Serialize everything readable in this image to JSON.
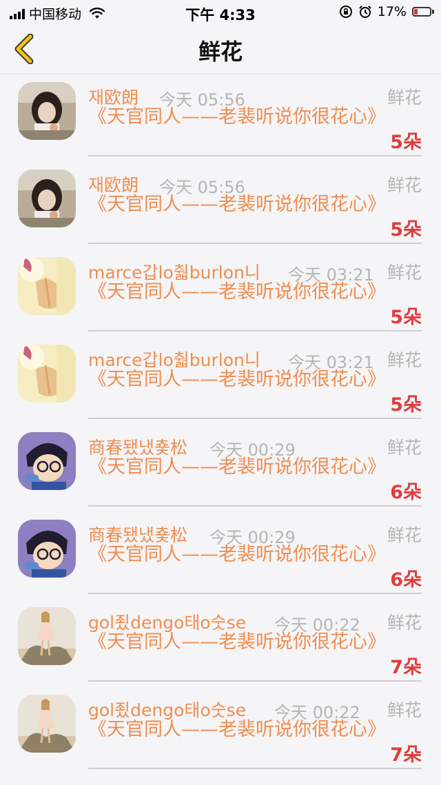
{
  "status_bar": {
    "carrier": "中国移动",
    "time": "下午 4:33",
    "battery_percent": "17%",
    "battery_level": 0.17
  },
  "nav": {
    "title": "鲜花",
    "back_icon": "chevron-left-icon"
  },
  "colors": {
    "accent_orange": "#f08d4f",
    "count_red": "#e03d3d",
    "muted_gray": "#b5b5b5",
    "back_yellow": "#f2c311"
  },
  "gifts": [
    {
      "user": "재欧朗",
      "time": "今天 05:56",
      "type": "鲜花",
      "book": "《天官同人——老裴听说你很花心》",
      "count": "5朵",
      "avatar": "avatar-photo-girl"
    },
    {
      "user": "재欧朗",
      "time": "今天 05:56",
      "type": "鲜花",
      "book": "《天官同人——老裴听说你很花心》",
      "count": "5朵",
      "avatar": "avatar-photo-girl"
    },
    {
      "user": "marce갑lo춻burlon니",
      "time": "今天 03:21",
      "type": "鲜花",
      "book": "《天官同人——老裴听说你很花心》",
      "count": "5朵",
      "avatar": "avatar-hands"
    },
    {
      "user": "marce갑lo춻burlon니",
      "time": "今天 03:21",
      "type": "鲜花",
      "book": "《天官同人——老裴听说你很花心》",
      "count": "5朵",
      "avatar": "avatar-hands"
    },
    {
      "user": "商春됐냈춏松",
      "time": "今天 00:29",
      "type": "鲜花",
      "book": "《天官同人——老裴听说你很花心》",
      "count": "6朵",
      "avatar": "avatar-anime-boy"
    },
    {
      "user": "商春됐냈춏松",
      "time": "今天 00:29",
      "type": "鲜花",
      "book": "《天官同人——老裴听说你很花心》",
      "count": "6朵",
      "avatar": "avatar-anime-boy"
    },
    {
      "user": "gol죘dengo태o숫se",
      "time": "今天 00:22",
      "type": "鲜花",
      "book": "《天官同人——老裴听说你很花心》",
      "count": "7朵",
      "avatar": "avatar-dress-girl"
    },
    {
      "user": "gol죘dengo태o숫se",
      "time": "今天 00:22",
      "type": "鲜花",
      "book": "《天官同人——老裴听说你很花心》",
      "count": "7朵",
      "avatar": "avatar-dress-girl"
    }
  ]
}
